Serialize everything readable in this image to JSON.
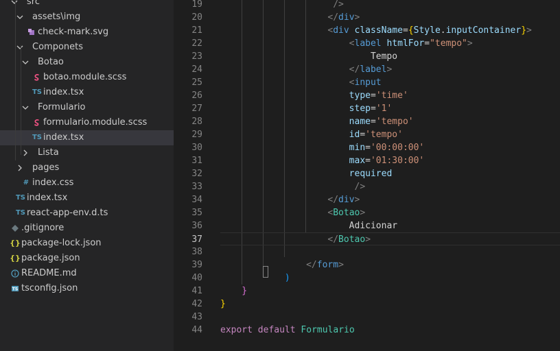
{
  "explorer": {
    "items": [
      {
        "label": "src",
        "icon": "chevron-down",
        "kind": "folder"
      },
      {
        "label": "assets\\img",
        "icon": "chevron-down",
        "kind": "folder"
      },
      {
        "label": "check-mark.svg",
        "icon": "svg-file-icon",
        "kind": "file"
      },
      {
        "label": "Componets",
        "icon": "chevron-down",
        "kind": "folder"
      },
      {
        "label": "Botao",
        "icon": "chevron-down",
        "kind": "folder"
      },
      {
        "label": "botao.module.scss",
        "icon": "scss-file-icon",
        "kind": "file"
      },
      {
        "label": "index.tsx",
        "icon": "ts-file-icon",
        "badge": "TS",
        "kind": "file"
      },
      {
        "label": "Formulario",
        "icon": "chevron-down",
        "kind": "folder"
      },
      {
        "label": "formulario.module.scss",
        "icon": "scss-file-icon",
        "kind": "file"
      },
      {
        "label": "index.tsx",
        "icon": "ts-file-icon",
        "badge": "TS",
        "kind": "file",
        "selected": true
      },
      {
        "label": "Lista",
        "icon": "chevron-right",
        "kind": "folder"
      },
      {
        "label": "pages",
        "icon": "chevron-right",
        "kind": "folder"
      },
      {
        "label": "index.css",
        "icon": "css-file-icon",
        "badge": "#",
        "kind": "file"
      },
      {
        "label": "index.tsx",
        "icon": "ts-file-icon",
        "badge": "TS",
        "kind": "file"
      },
      {
        "label": "react-app-env.d.ts",
        "icon": "ts-file-icon",
        "badge": "TS",
        "kind": "file"
      },
      {
        "label": ".gitignore",
        "icon": "git-file-icon",
        "kind": "file"
      },
      {
        "label": "package-lock.json",
        "icon": "json-file-icon",
        "badge": "{}",
        "kind": "file"
      },
      {
        "label": "package.json",
        "icon": "json-file-icon",
        "badge": "{}",
        "kind": "file"
      },
      {
        "label": "README.md",
        "icon": "info-file-icon",
        "badge": "i",
        "kind": "file"
      },
      {
        "label": "tsconfig.json",
        "icon": "tsconfig-file-icon",
        "badge": "TS",
        "kind": "file"
      }
    ]
  },
  "editor": {
    "current_line": 37,
    "lines": [
      {
        "n": "19",
        "tokens": [
          [
            "bracket",
            "/>"
          ]
        ]
      },
      {
        "n": "20",
        "tokens": [
          [
            "bracket",
            "</"
          ],
          [
            "tag",
            "div"
          ],
          [
            "bracket",
            ">"
          ]
        ]
      },
      {
        "n": "21",
        "tokens": [
          [
            "bracket",
            "<"
          ],
          [
            "tag",
            "div"
          ],
          [
            "text",
            " "
          ],
          [
            "attr",
            "className"
          ],
          [
            "text",
            "="
          ],
          [
            "brace",
            "{"
          ],
          [
            "attr",
            "Style"
          ],
          [
            "text",
            "."
          ],
          [
            "attr",
            "inputContainer"
          ],
          [
            "brace",
            "}"
          ],
          [
            "bracket",
            ">"
          ]
        ]
      },
      {
        "n": "22",
        "tokens": [
          [
            "bracket",
            "<"
          ],
          [
            "tag",
            "label"
          ],
          [
            "text",
            " "
          ],
          [
            "attr",
            "htmlFor"
          ],
          [
            "text",
            "="
          ],
          [
            "str",
            "\"tempo\""
          ],
          [
            "bracket",
            ">"
          ]
        ]
      },
      {
        "n": "23",
        "tokens": [
          [
            "text",
            "Tempo"
          ]
        ]
      },
      {
        "n": "24",
        "tokens": [
          [
            "bracket",
            "</"
          ],
          [
            "tag",
            "label"
          ],
          [
            "bracket",
            ">"
          ]
        ]
      },
      {
        "n": "25",
        "tokens": [
          [
            "bracket",
            "<"
          ],
          [
            "tag",
            "input"
          ]
        ]
      },
      {
        "n": "26",
        "tokens": [
          [
            "attr",
            "type"
          ],
          [
            "text",
            "="
          ],
          [
            "str",
            "'time'"
          ]
        ]
      },
      {
        "n": "27",
        "tokens": [
          [
            "attr",
            "step"
          ],
          [
            "text",
            "="
          ],
          [
            "str",
            "'1'"
          ]
        ]
      },
      {
        "n": "28",
        "tokens": [
          [
            "attr",
            "name"
          ],
          [
            "text",
            "="
          ],
          [
            "str",
            "'tempo'"
          ]
        ]
      },
      {
        "n": "29",
        "tokens": [
          [
            "attr",
            "id"
          ],
          [
            "text",
            "="
          ],
          [
            "str",
            "'tempo'"
          ]
        ]
      },
      {
        "n": "30",
        "tokens": [
          [
            "attr",
            "min"
          ],
          [
            "text",
            "="
          ],
          [
            "str",
            "'00:00:00'"
          ]
        ]
      },
      {
        "n": "31",
        "tokens": [
          [
            "attr",
            "max"
          ],
          [
            "text",
            "="
          ],
          [
            "str",
            "'01:30:00'"
          ]
        ]
      },
      {
        "n": "32",
        "tokens": [
          [
            "attr",
            "required"
          ]
        ]
      },
      {
        "n": "33",
        "tokens": [
          [
            "bracket",
            "/>"
          ]
        ]
      },
      {
        "n": "34",
        "tokens": [
          [
            "bracket",
            "</"
          ],
          [
            "tag",
            "div"
          ],
          [
            "bracket",
            ">"
          ]
        ]
      },
      {
        "n": "35",
        "tokens": [
          [
            "bracket",
            "<"
          ],
          [
            "comp",
            "Botao"
          ],
          [
            "bracket",
            ">"
          ]
        ]
      },
      {
        "n": "36",
        "tokens": [
          [
            "text",
            "Adicionar"
          ]
        ]
      },
      {
        "n": "37",
        "tokens": [
          [
            "bracket",
            "</"
          ],
          [
            "comp",
            "Botao"
          ],
          [
            "bracket",
            ">"
          ]
        ]
      },
      {
        "n": "38",
        "tokens": []
      },
      {
        "n": "39",
        "tokens": [
          [
            "bracket",
            "</"
          ],
          [
            "tag",
            "form"
          ],
          [
            "bracket",
            ">"
          ]
        ]
      },
      {
        "n": "40",
        "tokens": [
          [
            "brace3",
            ")"
          ]
        ]
      },
      {
        "n": "41",
        "tokens": [
          [
            "brace2",
            "}"
          ]
        ]
      },
      {
        "n": "42",
        "tokens": [
          [
            "brace",
            "}"
          ]
        ]
      },
      {
        "n": "43",
        "tokens": []
      },
      {
        "n": "44",
        "tokens": [
          [
            "kw",
            "export"
          ],
          [
            "text",
            " "
          ],
          [
            "kw",
            "default"
          ],
          [
            "text",
            " "
          ],
          [
            "comp",
            "Formulario"
          ]
        ]
      }
    ]
  },
  "colors": {
    "editor_bg": "#1e1e1e",
    "sidebar_bg": "#252526",
    "selected_bg": "#37373d",
    "tag": "#569cd6",
    "attr": "#9cdcfe",
    "string": "#ce9178",
    "component": "#4ec9b0",
    "keyword": "#c586c0"
  }
}
